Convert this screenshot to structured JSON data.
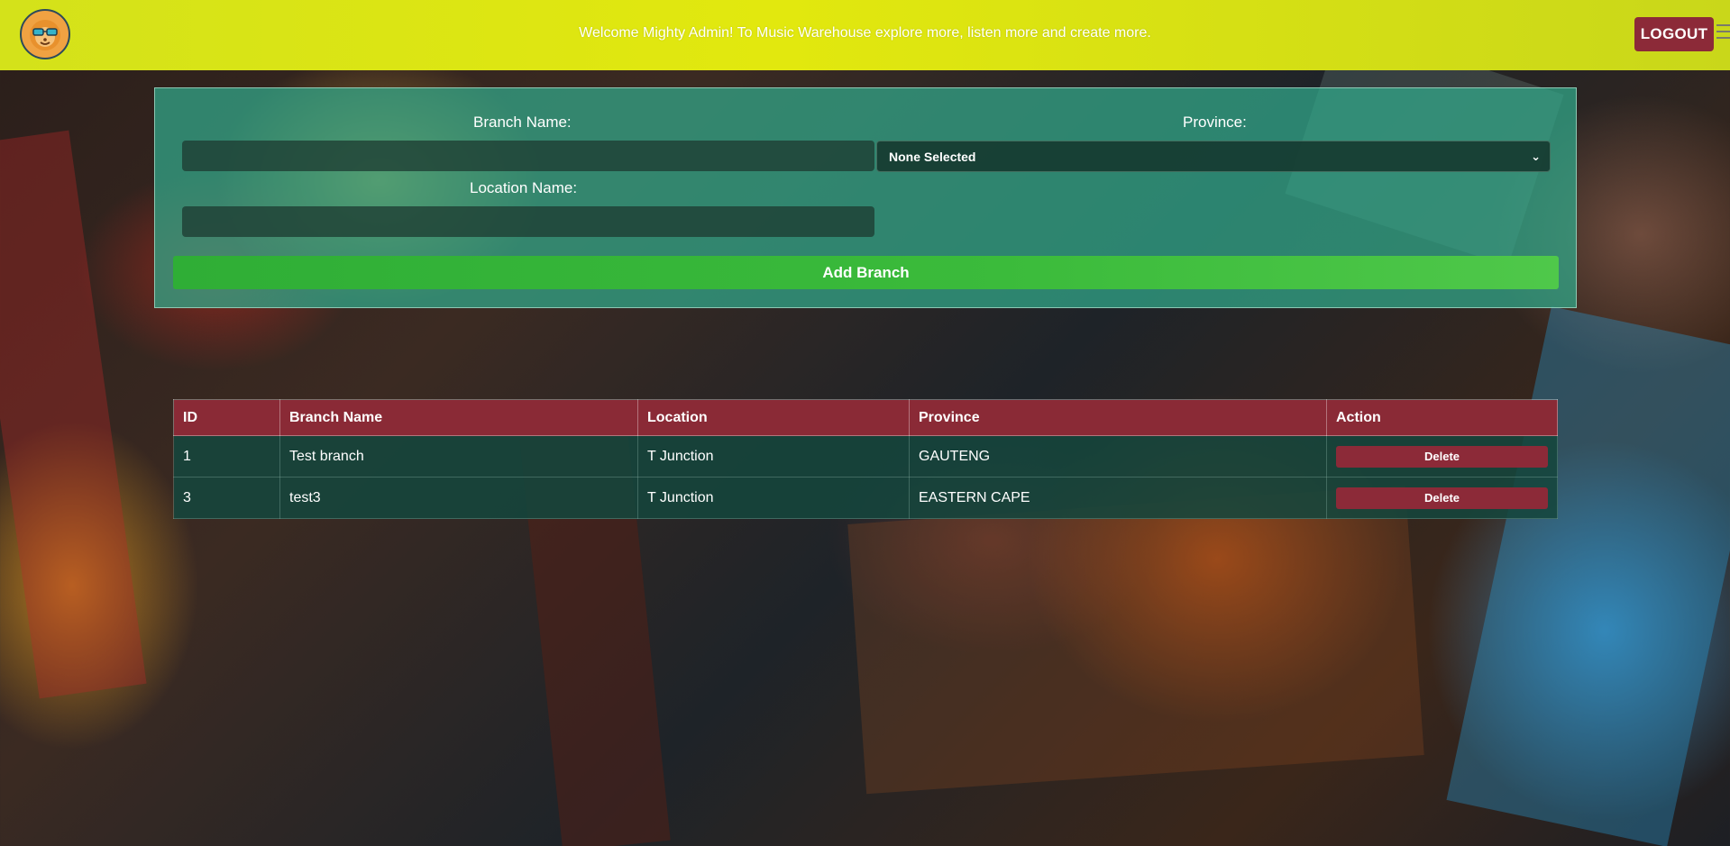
{
  "header": {
    "welcome_text": "Welcome Mighty Admin! To Music Warehouse explore more, listen more and create more.",
    "logout_label": "LOGOUT"
  },
  "form": {
    "branch_name_label": "Branch Name:",
    "province_label": "Province:",
    "location_name_label": "Location Name:",
    "branch_name_value": "",
    "location_name_value": "",
    "province_selected": "None Selected",
    "add_button_label": "Add Branch"
  },
  "table": {
    "columns": [
      "ID",
      "Branch Name",
      "Location",
      "Province",
      "Action"
    ],
    "rows": [
      {
        "id": "1",
        "branch_name": "Test branch",
        "location": "T Junction",
        "province": "GAUTENG",
        "action": "Delete"
      },
      {
        "id": "3",
        "branch_name": "test3",
        "location": "T Junction",
        "province": "EASTERN CAPE",
        "action": "Delete"
      }
    ]
  },
  "colors": {
    "header_bg": "#d4e21a",
    "accent_red": "#8c2a38",
    "add_green": "#3bbb3b",
    "panel_teal": "#32aa8c"
  }
}
